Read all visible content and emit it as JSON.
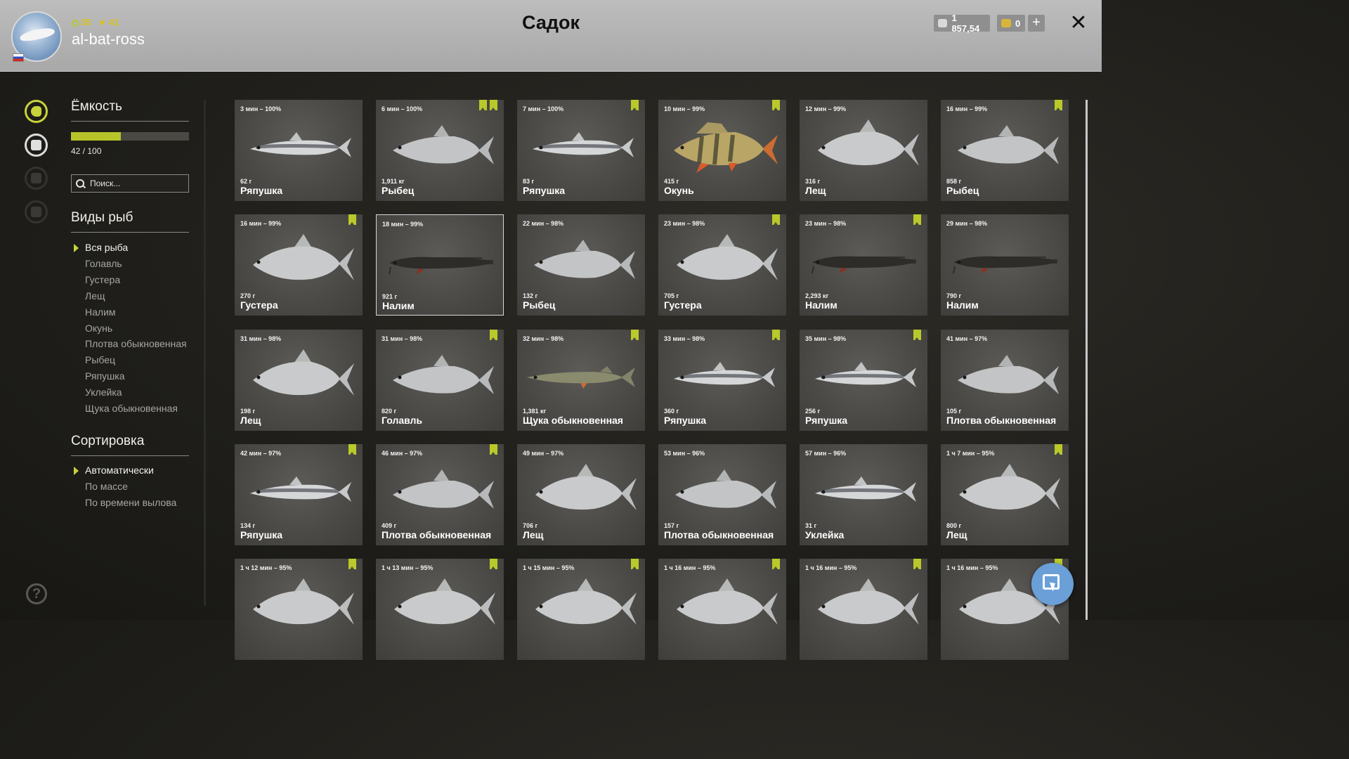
{
  "header": {
    "level": "35",
    "rank": "41",
    "username": "al-bat-ross",
    "title": "Садок",
    "silver": "1 857,54",
    "gold": "0",
    "plus_label": "+",
    "close_label": "✕"
  },
  "sidebar": {
    "capacity_title": "Ёмкость",
    "capacity_value": 42,
    "capacity_max": 100,
    "capacity_text": "42 / 100",
    "search_placeholder": "Поиск...",
    "species_title": "Виды рыб",
    "species": [
      "Вся рыба",
      "Голавль",
      "Густера",
      "Лещ",
      "Налим",
      "Окунь",
      "Плотва обыкновенная",
      "Рыбец",
      "Ряпушка",
      "Уклейка",
      "Щука обыкновенная"
    ],
    "species_selected": 0,
    "sort_title": "Сортировка",
    "sort": [
      "Автоматически",
      "По массе",
      "По времени вылова"
    ],
    "sort_selected": 0,
    "help_label": "?"
  },
  "cards": [
    {
      "time": "3 мин – 100%",
      "weight": "62 г",
      "name": "Ряпушка",
      "kind": "slim",
      "bm": 0
    },
    {
      "time": "6 мин – 100%",
      "weight": "1,911 кг",
      "name": "Рыбец",
      "kind": "roach",
      "bm": 2
    },
    {
      "time": "7 мин – 100%",
      "weight": "83 г",
      "name": "Ряпушка",
      "kind": "slim",
      "bm": 1
    },
    {
      "time": "10 мин – 99%",
      "weight": "415 г",
      "name": "Окунь",
      "kind": "perch",
      "bm": 1
    },
    {
      "time": "12 мин – 99%",
      "weight": "316 г",
      "name": "Лещ",
      "kind": "bream",
      "bm": 0
    },
    {
      "time": "16 мин – 99%",
      "weight": "858 г",
      "name": "Рыбец",
      "kind": "roach",
      "bm": 1
    },
    {
      "time": "16 мин – 99%",
      "weight": "270 г",
      "name": "Густера",
      "kind": "bream",
      "bm": 1
    },
    {
      "time": "18 мин – 99%",
      "weight": "921 г",
      "name": "Налим",
      "kind": "burbot",
      "bm": 0,
      "selected": true
    },
    {
      "time": "22 мин – 98%",
      "weight": "132 г",
      "name": "Рыбец",
      "kind": "roach",
      "bm": 0
    },
    {
      "time": "23 мин – 98%",
      "weight": "705 г",
      "name": "Густера",
      "kind": "bream",
      "bm": 1
    },
    {
      "time": "23 мин – 98%",
      "weight": "2,293 кг",
      "name": "Налим",
      "kind": "burbot",
      "bm": 1
    },
    {
      "time": "29 мин – 98%",
      "weight": "790 г",
      "name": "Налим",
      "kind": "burbot",
      "bm": 0
    },
    {
      "time": "31 мин – 98%",
      "weight": "198 г",
      "name": "Лещ",
      "kind": "bream",
      "bm": 0
    },
    {
      "time": "31 мин – 98%",
      "weight": "820 г",
      "name": "Голавль",
      "kind": "roach",
      "bm": 1
    },
    {
      "time": "32 мин – 98%",
      "weight": "1,381 кг",
      "name": "Щука обыкновенная",
      "kind": "pike",
      "bm": 1
    },
    {
      "time": "33 мин – 98%",
      "weight": "360 г",
      "name": "Ряпушка",
      "kind": "slim",
      "bm": 1
    },
    {
      "time": "35 мин – 98%",
      "weight": "256 г",
      "name": "Ряпушка",
      "kind": "slim",
      "bm": 1
    },
    {
      "time": "41 мин – 97%",
      "weight": "105 г",
      "name": "Плотва обыкновенная",
      "kind": "roach",
      "bm": 0
    },
    {
      "time": "42 мин – 97%",
      "weight": "134 г",
      "name": "Ряпушка",
      "kind": "slim",
      "bm": 1
    },
    {
      "time": "46 мин – 97%",
      "weight": "409 г",
      "name": "Плотва обыкновенная",
      "kind": "roach",
      "bm": 1
    },
    {
      "time": "49 мин – 97%",
      "weight": "706 г",
      "name": "Лещ",
      "kind": "bream",
      "bm": 0
    },
    {
      "time": "53 мин – 96%",
      "weight": "157 г",
      "name": "Плотва обыкновенная",
      "kind": "roach",
      "bm": 0
    },
    {
      "time": "57 мин – 96%",
      "weight": "31 г",
      "name": "Уклейка",
      "kind": "slim",
      "bm": 0
    },
    {
      "time": "1 ч 7 мин – 95%",
      "weight": "800 г",
      "name": "Лещ",
      "kind": "bream",
      "bm": 1
    },
    {
      "time": "1 ч 12 мин – 95%",
      "weight": "",
      "name": "",
      "kind": "bream",
      "bm": 1
    },
    {
      "time": "1 ч 13 мин – 95%",
      "weight": "",
      "name": "",
      "kind": "bream",
      "bm": 1
    },
    {
      "time": "1 ч 15 мин – 95%",
      "weight": "",
      "name": "",
      "kind": "bream",
      "bm": 1
    },
    {
      "time": "1 ч 16 мин – 95%",
      "weight": "",
      "name": "",
      "kind": "bream",
      "bm": 1
    },
    {
      "time": "1 ч 16 мин – 95%",
      "weight": "",
      "name": "",
      "kind": "bream",
      "bm": 1
    },
    {
      "time": "1 ч 16 мин – 95%",
      "weight": "",
      "name": "",
      "kind": "bream",
      "bm": 1
    }
  ],
  "icons": [
    "fish-icon",
    "keepnet-icon",
    "level-locked-icon",
    "home-locked-icon",
    "help-icon",
    "silver-coin-icon",
    "gold-coin-icon",
    "bookmark-icon",
    "close-icon",
    "cursor-icon"
  ],
  "colors": {
    "accent": "#b9c92a",
    "header_bg": "#b3b3b3",
    "card_bg": "#4a4946",
    "fab": "#6a9fd8"
  }
}
